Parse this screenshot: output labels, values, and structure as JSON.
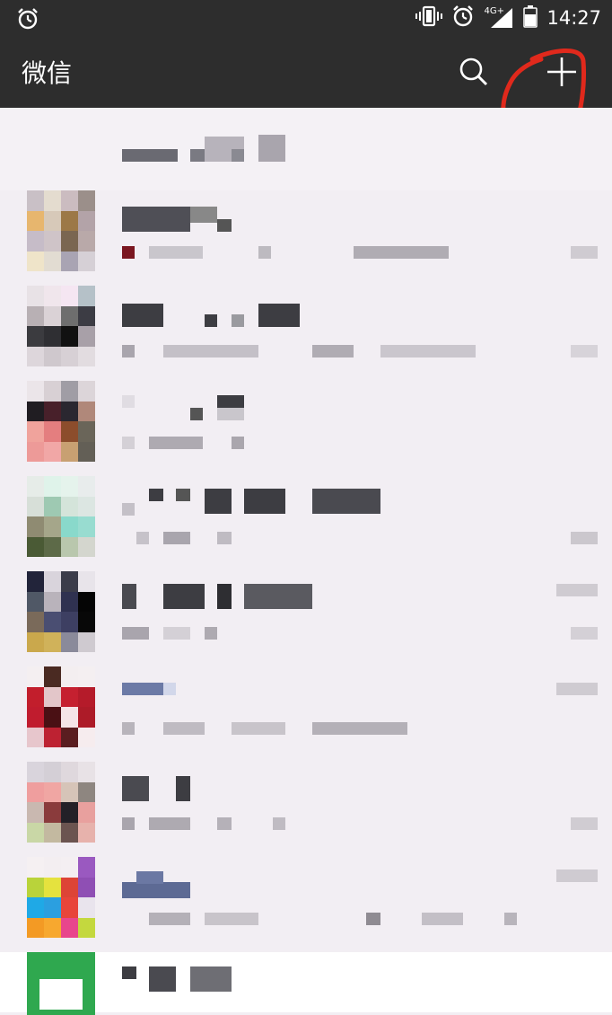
{
  "status_bar": {
    "time": "14:27",
    "network": "4G+",
    "icons": [
      "alarm-icon",
      "vibrate-icon",
      "alarm-icon",
      "signal-icon",
      "battery-icon"
    ]
  },
  "app_bar": {
    "title": "微信",
    "search_icon": "search-icon",
    "add_icon": "plus-icon",
    "annotation_color": "#e0291c"
  },
  "colors": {
    "header_bg": "#2d2d2d",
    "list_bg": "#f2eef3",
    "green_avatar": "#2fa84f"
  },
  "conversations": [
    {
      "name": "",
      "preview": "",
      "time": ""
    },
    {
      "name": "",
      "preview": "",
      "time": ""
    },
    {
      "name": "",
      "preview": "",
      "time": ""
    },
    {
      "name": "",
      "preview": "",
      "time": ""
    },
    {
      "name": "",
      "preview": "",
      "time": ""
    },
    {
      "name": "",
      "preview": "",
      "time": ""
    },
    {
      "name": "",
      "preview": "",
      "time": ""
    },
    {
      "name": "",
      "preview": "",
      "time": ""
    },
    {
      "name": "",
      "preview": "",
      "time": ""
    }
  ]
}
